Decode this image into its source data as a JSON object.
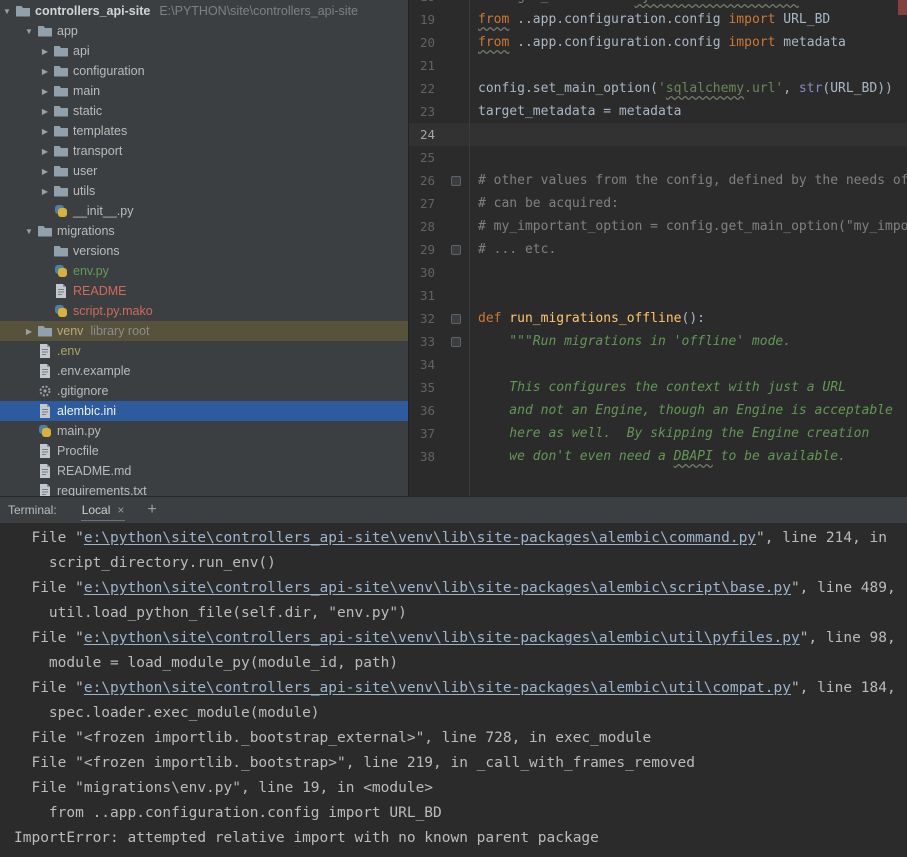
{
  "colors": {
    "selection_blue": "#2d5b9e",
    "venv_highlight": "#56523c",
    "keyword_orange": "#cc7832",
    "string_green": "#6a8759",
    "docstring_green": "#629755",
    "comment_gray": "#808080",
    "function_yellow": "#ffc66d",
    "error_stripe_red": "#83423d"
  },
  "project": {
    "root": {
      "name": "controllers_api-site",
      "path": "E:\\PYTHON\\site\\controllers_api-site"
    },
    "items": [
      {
        "label": "app",
        "indent": 1,
        "expand": "open",
        "icon": "folder"
      },
      {
        "label": "api",
        "indent": 2,
        "expand": "closed",
        "icon": "folder"
      },
      {
        "label": "configuration",
        "indent": 2,
        "expand": "closed",
        "icon": "folder"
      },
      {
        "label": "main",
        "indent": 2,
        "expand": "closed",
        "icon": "folder"
      },
      {
        "label": "static",
        "indent": 2,
        "expand": "closed",
        "icon": "folder"
      },
      {
        "label": "templates",
        "indent": 2,
        "expand": "closed",
        "icon": "folder"
      },
      {
        "label": "transport",
        "indent": 2,
        "expand": "closed",
        "icon": "folder"
      },
      {
        "label": "user",
        "indent": 2,
        "expand": "closed",
        "icon": "folder"
      },
      {
        "label": "utils",
        "indent": 2,
        "expand": "closed",
        "icon": "folder"
      },
      {
        "label": "__init__.py",
        "indent": 2,
        "expand": "none",
        "icon": "python"
      },
      {
        "label": "migrations",
        "indent": 1,
        "expand": "open",
        "icon": "folder"
      },
      {
        "label": "versions",
        "indent": 2,
        "expand": "none",
        "icon": "folder"
      },
      {
        "label": "env.py",
        "indent": 2,
        "expand": "none",
        "icon": "python",
        "color": "#699856"
      },
      {
        "label": "README",
        "indent": 2,
        "expand": "none",
        "icon": "file",
        "color": "#cf6a5d"
      },
      {
        "label": "script.py.mako",
        "indent": 2,
        "expand": "none",
        "icon": "python",
        "color": "#cf6a5d"
      },
      {
        "label": "venv",
        "indent": 1,
        "expand": "closed",
        "icon": "folder",
        "sub": "library root",
        "row": "venv"
      },
      {
        "label": ".env",
        "indent": 1,
        "expand": "none",
        "icon": "file",
        "color": "#a9a95f"
      },
      {
        "label": ".env.example",
        "indent": 1,
        "expand": "none",
        "icon": "file"
      },
      {
        "label": ".gitignore",
        "indent": 1,
        "expand": "none",
        "icon": "gear"
      },
      {
        "label": "alembic.ini",
        "indent": 1,
        "expand": "none",
        "icon": "file",
        "row": "selected"
      },
      {
        "label": "main.py",
        "indent": 1,
        "expand": "none",
        "icon": "python"
      },
      {
        "label": "Procfile",
        "indent": 1,
        "expand": "none",
        "icon": "file"
      },
      {
        "label": "README.md",
        "indent": 1,
        "expand": "none",
        "icon": "file"
      },
      {
        "label": "requirements.txt",
        "indent": 1,
        "expand": "none",
        "icon": "file"
      }
    ]
  },
  "editor": {
    "current_line": 24,
    "lines": [
      {
        "num": 18,
        "segs": [
          [
            "com",
            "# target_metadata = "
          ],
          [
            "com u",
            "mymodel.Base.metadata"
          ]
        ]
      },
      {
        "num": 19,
        "segs": [
          [
            "kw u",
            "from"
          ],
          [
            "d",
            " ..app.configuration.config "
          ],
          [
            "kw",
            "import"
          ],
          [
            "d",
            " URL_BD"
          ]
        ]
      },
      {
        "num": 20,
        "segs": [
          [
            "kw u",
            "from"
          ],
          [
            "d",
            " ..app.configuration.config "
          ],
          [
            "kw",
            "import"
          ],
          [
            "d",
            " metadata"
          ]
        ]
      },
      {
        "num": 21,
        "segs": []
      },
      {
        "num": 22,
        "segs": [
          [
            "d",
            "config.set_main_option("
          ],
          [
            "str",
            "'"
          ],
          [
            "str u",
            "sqlalchemy"
          ],
          [
            "str",
            ".url'"
          ],
          [
            "d",
            ", "
          ],
          [
            "bi",
            "str"
          ],
          [
            "d",
            "(URL_BD))"
          ]
        ]
      },
      {
        "num": 23,
        "segs": [
          [
            "d",
            "target_metadata = metadata"
          ]
        ]
      },
      {
        "num": 24,
        "segs": []
      },
      {
        "num": 25,
        "segs": []
      },
      {
        "num": 26,
        "gutter": true,
        "segs": [
          [
            "com",
            "# other values from the config, defined by the needs of"
          ]
        ]
      },
      {
        "num": 27,
        "segs": [
          [
            "com",
            "# can be acquired:"
          ]
        ]
      },
      {
        "num": 28,
        "segs": [
          [
            "com",
            "# my_important_option = config.get_main_option(\"my_important_option\")"
          ]
        ]
      },
      {
        "num": 29,
        "gutter": true,
        "segs": [
          [
            "com",
            "# ... etc."
          ]
        ]
      },
      {
        "num": 30,
        "segs": []
      },
      {
        "num": 31,
        "segs": []
      },
      {
        "num": 32,
        "gutter": true,
        "segs": [
          [
            "kw",
            "def"
          ],
          [
            "fn",
            " run_migrations_offline"
          ],
          [
            "d",
            "():"
          ]
        ]
      },
      {
        "num": 33,
        "gutter": true,
        "segs": [
          [
            "doc",
            "    \"\"\"Run migrations in 'offline' mode."
          ]
        ]
      },
      {
        "num": 34,
        "segs": []
      },
      {
        "num": 35,
        "segs": [
          [
            "doc",
            "    This configures the context with just a URL"
          ]
        ]
      },
      {
        "num": 36,
        "segs": [
          [
            "doc",
            "    and not an Engine, though an Engine is acceptable"
          ]
        ]
      },
      {
        "num": 37,
        "segs": [
          [
            "doc",
            "    here as well.  By skipping the Engine creation"
          ]
        ]
      },
      {
        "num": 38,
        "segs": [
          [
            "doc",
            "    we don't even need a "
          ],
          [
            "doc u",
            "DBAPI"
          ],
          [
            "doc",
            " to be available."
          ]
        ]
      }
    ]
  },
  "terminal": {
    "panel_label": "Terminal:",
    "tab_label": "Local",
    "close_label": "×",
    "new_tab_label": "+",
    "lines": [
      {
        "segs": [
          [
            "t",
            "  File \""
          ],
          [
            "link",
            "e:\\python\\site\\controllers_api-site\\venv\\lib\\site-packages\\alembic\\command.py"
          ],
          [
            "t",
            "\", line 214, in"
          ]
        ]
      },
      {
        "segs": [
          [
            "t",
            "    script_directory.run_env()"
          ]
        ]
      },
      {
        "segs": [
          [
            "t",
            "  File \""
          ],
          [
            "link",
            "e:\\python\\site\\controllers_api-site\\venv\\lib\\site-packages\\alembic\\script\\base.py"
          ],
          [
            "t",
            "\", line 489,"
          ]
        ]
      },
      {
        "segs": [
          [
            "t",
            "    util.load_python_file(self.dir, \"env.py\")"
          ]
        ]
      },
      {
        "segs": [
          [
            "t",
            "  File \""
          ],
          [
            "link",
            "e:\\python\\site\\controllers_api-site\\venv\\lib\\site-packages\\alembic\\util\\pyfiles.py"
          ],
          [
            "t",
            "\", line 98,"
          ]
        ]
      },
      {
        "segs": [
          [
            "t",
            "    module = load_module_py(module_id, path)"
          ]
        ]
      },
      {
        "segs": [
          [
            "t",
            "  File \""
          ],
          [
            "link",
            "e:\\python\\site\\controllers_api-site\\venv\\lib\\site-packages\\alembic\\util\\compat.py"
          ],
          [
            "t",
            "\", line 184,"
          ]
        ]
      },
      {
        "segs": [
          [
            "t",
            "    spec.loader.exec_module(module)"
          ]
        ]
      },
      {
        "segs": [
          [
            "t",
            "  File \"<frozen importlib._bootstrap_external>\", line 728, in exec_module"
          ]
        ]
      },
      {
        "segs": [
          [
            "t",
            "  File \"<frozen importlib._bootstrap>\", line 219, in _call_with_frames_removed"
          ]
        ]
      },
      {
        "segs": [
          [
            "t",
            "  File \"migrations\\env.py\", line 19, in <module>"
          ]
        ]
      },
      {
        "segs": [
          [
            "t",
            "    from ..app.configuration.config import URL_BD"
          ]
        ]
      },
      {
        "segs": [
          [
            "t",
            "ImportError: attempted relative import with no known parent package"
          ]
        ]
      }
    ]
  }
}
